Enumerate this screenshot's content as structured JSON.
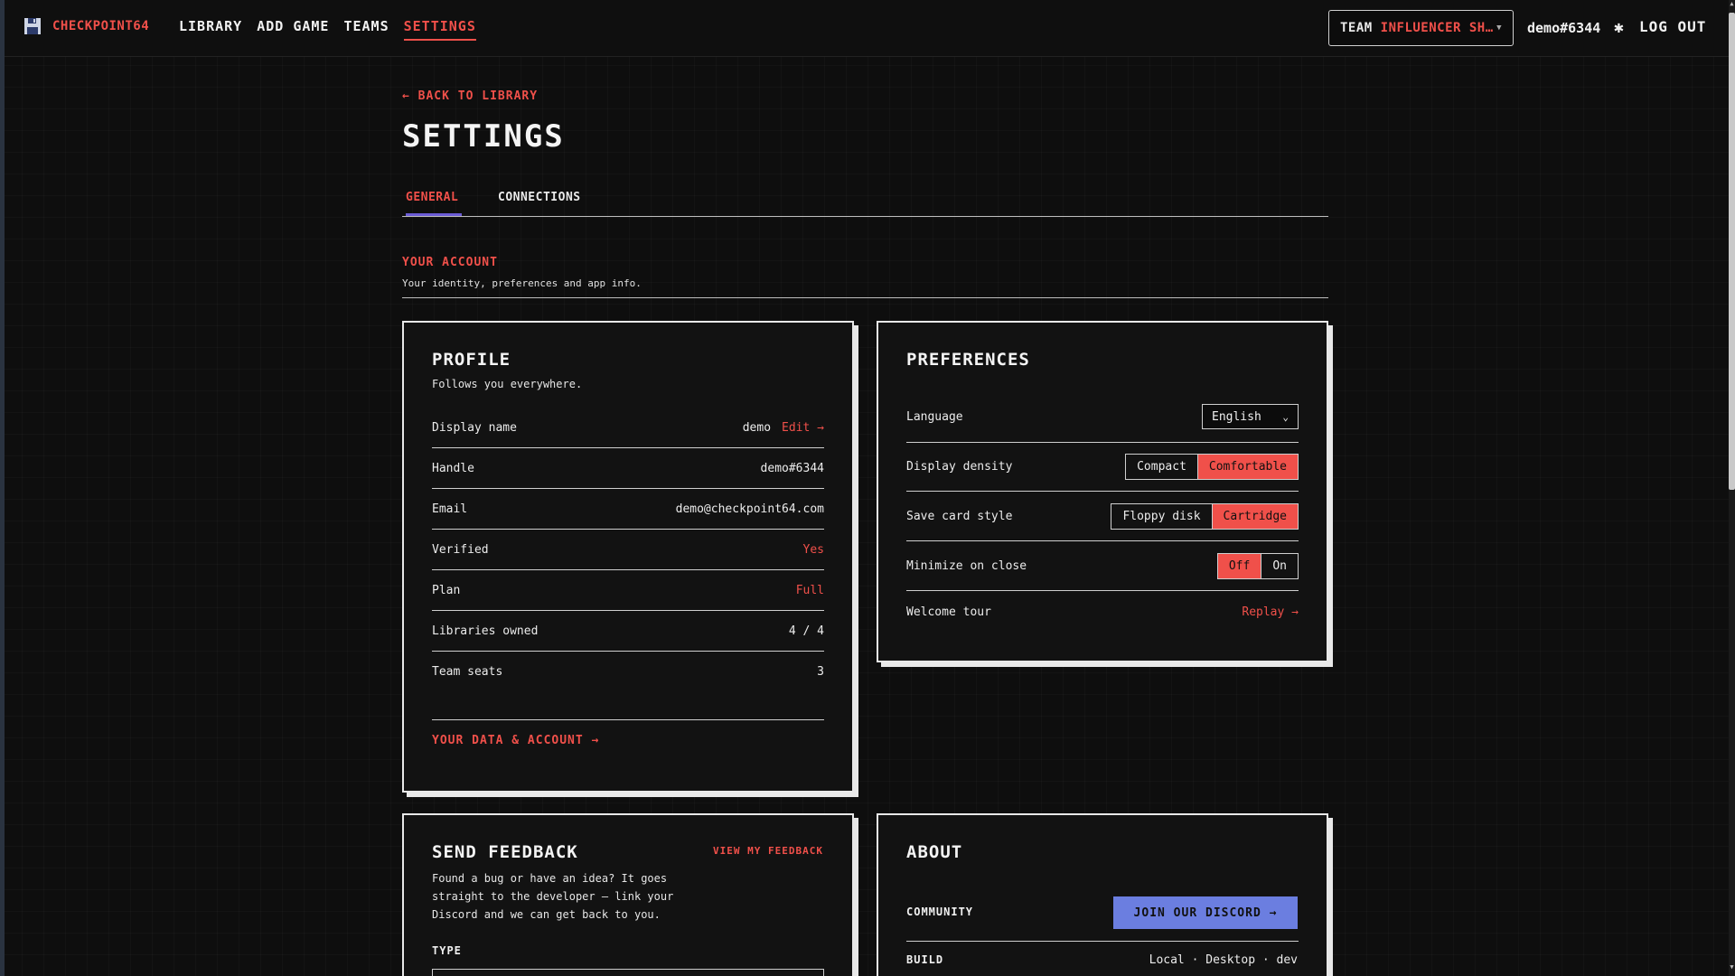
{
  "nav": {
    "brand": "CHECKPOINT64",
    "links": [
      "LIBRARY",
      "ADD GAME",
      "TEAMS",
      "SETTINGS"
    ],
    "active": "SETTINGS",
    "team_prefix": "TEAM ",
    "team_name": "INFLUENCER SH…",
    "user_handle": "demo#6344",
    "logout": "LOG OUT"
  },
  "page": {
    "back": "← BACK TO LIBRARY",
    "title": "SETTINGS",
    "tabs": [
      "GENERAL",
      "CONNECTIONS"
    ],
    "active_tab": "GENERAL",
    "section_title": "YOUR ACCOUNT",
    "section_sub": "Your identity, preferences and app info."
  },
  "profile": {
    "title": "PROFILE",
    "subtitle": "Follows you everywhere.",
    "rows": [
      {
        "label": "Display name",
        "value": "demo",
        "action": "Edit →"
      },
      {
        "label": "Handle",
        "value": "demo#6344"
      },
      {
        "label": "Email",
        "value": "demo@checkpoint64.com"
      },
      {
        "label": "Verified",
        "value": "Yes"
      },
      {
        "label": "Plan",
        "value": "Full"
      },
      {
        "label": "Libraries owned",
        "value": "4 / 4"
      },
      {
        "label": "Team seats",
        "value": "3"
      }
    ],
    "data_link": "YOUR DATA & ACCOUNT →"
  },
  "preferences": {
    "title": "PREFERENCES",
    "language_label": "Language",
    "language_value": "English",
    "density_label": "Display density",
    "density_options": [
      "Compact",
      "Comfortable"
    ],
    "density_selected": "Comfortable",
    "card_style_label": "Save card style",
    "card_style_options": [
      "Floppy disk",
      "Cartridge"
    ],
    "card_style_selected": "Cartridge",
    "minimize_label": "Minimize on close",
    "minimize_options": [
      "Off",
      "On"
    ],
    "minimize_selected": "Off",
    "tour_label": "Welcome tour",
    "tour_action": "Replay →"
  },
  "feedback": {
    "title": "SEND FEEDBACK",
    "view_link": "VIEW MY FEEDBACK",
    "body_lines": [
      "Found a bug or have an idea? It goes",
      "straight to the developer — link your",
      "Discord and we can get back to you."
    ],
    "type_label": "TYPE"
  },
  "about": {
    "title": "ABOUT",
    "community_label": "COMMUNITY",
    "discord_button": "JOIN OUR DISCORD →",
    "build_label": "BUILD",
    "build_value": "Local · Desktop · dev"
  },
  "colors": {
    "accent": "#f0504a",
    "discord": "#6b7ee0",
    "tab_underline": "#6b5cd6"
  }
}
